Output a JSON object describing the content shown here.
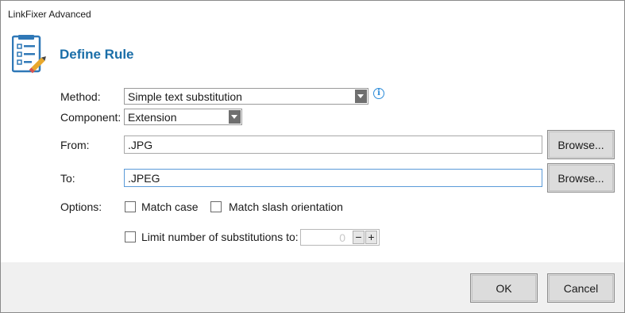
{
  "window": {
    "title": "LinkFixer Advanced"
  },
  "header": {
    "title": "Define Rule",
    "icon": "checklist-edit-icon"
  },
  "form": {
    "method": {
      "label": "Method:",
      "value": "Simple text substitution"
    },
    "component": {
      "label": "Component:",
      "value": "Extension"
    },
    "from": {
      "label": "From:",
      "value": ".JPG",
      "browse_label": "Browse..."
    },
    "to": {
      "label": "To:",
      "value": ".JPEG",
      "browse_label": "Browse..."
    },
    "options": {
      "label": "Options:",
      "match_case": {
        "label": "Match case",
        "checked": false
      },
      "match_slash": {
        "label": "Match slash orientation",
        "checked": false
      },
      "limit": {
        "label": "Limit number of substitutions to:",
        "checked": false,
        "value": "0"
      }
    }
  },
  "footer": {
    "ok_label": "OK",
    "cancel_label": "Cancel"
  }
}
